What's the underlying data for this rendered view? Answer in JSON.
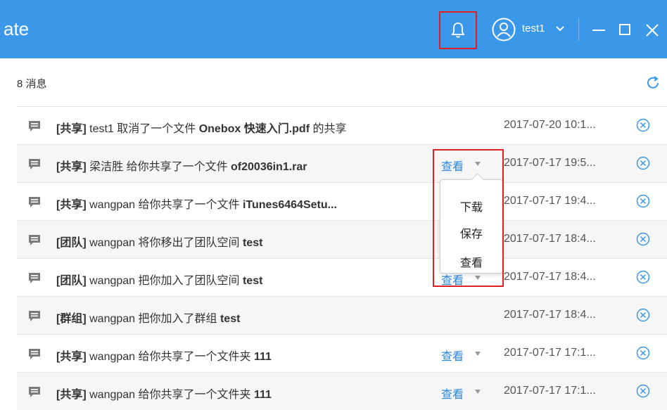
{
  "titlebar": {
    "app_title": "ate",
    "username": "test1",
    "bell_icon": "bell-icon",
    "avatar_icon": "user-circle-icon"
  },
  "header": {
    "message_count": "8 消息",
    "refresh_icon": "refresh-icon"
  },
  "messages": [
    {
      "category": "[共享]",
      "text": " test1 取消了一个文件 ",
      "object": "Onebox 快速入门.pdf",
      "suffix": " 的共享",
      "view": "",
      "date": "2017-07-20 10:1..."
    },
    {
      "category": "[共享]",
      "text": " 梁洁胜 给你共享了一个文件 ",
      "object": "of20036in1.rar",
      "suffix": "",
      "view": "查看",
      "date": "2017-07-17 19:5..."
    },
    {
      "category": "[共享]",
      "text": " wangpan 给你共享了一个文件 ",
      "object": "iTunes6464Setu...",
      "suffix": "",
      "view": "",
      "date": "2017-07-17 19:4..."
    },
    {
      "category": "[团队]",
      "text": " wangpan 将你移出了团队空间 ",
      "object": "test",
      "suffix": "",
      "view": "",
      "date": "2017-07-17 18:4..."
    },
    {
      "category": "[团队]",
      "text": " wangpan 把你加入了团队空间 ",
      "object": "test",
      "suffix": "",
      "view": "查看",
      "date": "2017-07-17 18:4..."
    },
    {
      "category": "[群组]",
      "text": " wangpan 把你加入了群组 ",
      "object": "test",
      "suffix": "",
      "view": "",
      "date": "2017-07-17 18:4..."
    },
    {
      "category": "[共享]",
      "text": " wangpan 给你共享了一个文件夹 ",
      "object": "111",
      "suffix": "",
      "view": "查看",
      "date": "2017-07-17 17:1..."
    },
    {
      "category": "[共享]",
      "text": " wangpan 给你共享了一个文件夹 ",
      "object": "111",
      "suffix": "",
      "view": "查看",
      "date": "2017-07-17 17:1..."
    }
  ],
  "dropdown": {
    "items": [
      "下载",
      "保存",
      "查看"
    ]
  },
  "colors": {
    "titlebar": "#3b98e8",
    "link": "#2b86d9",
    "highlight": "#e02020"
  }
}
